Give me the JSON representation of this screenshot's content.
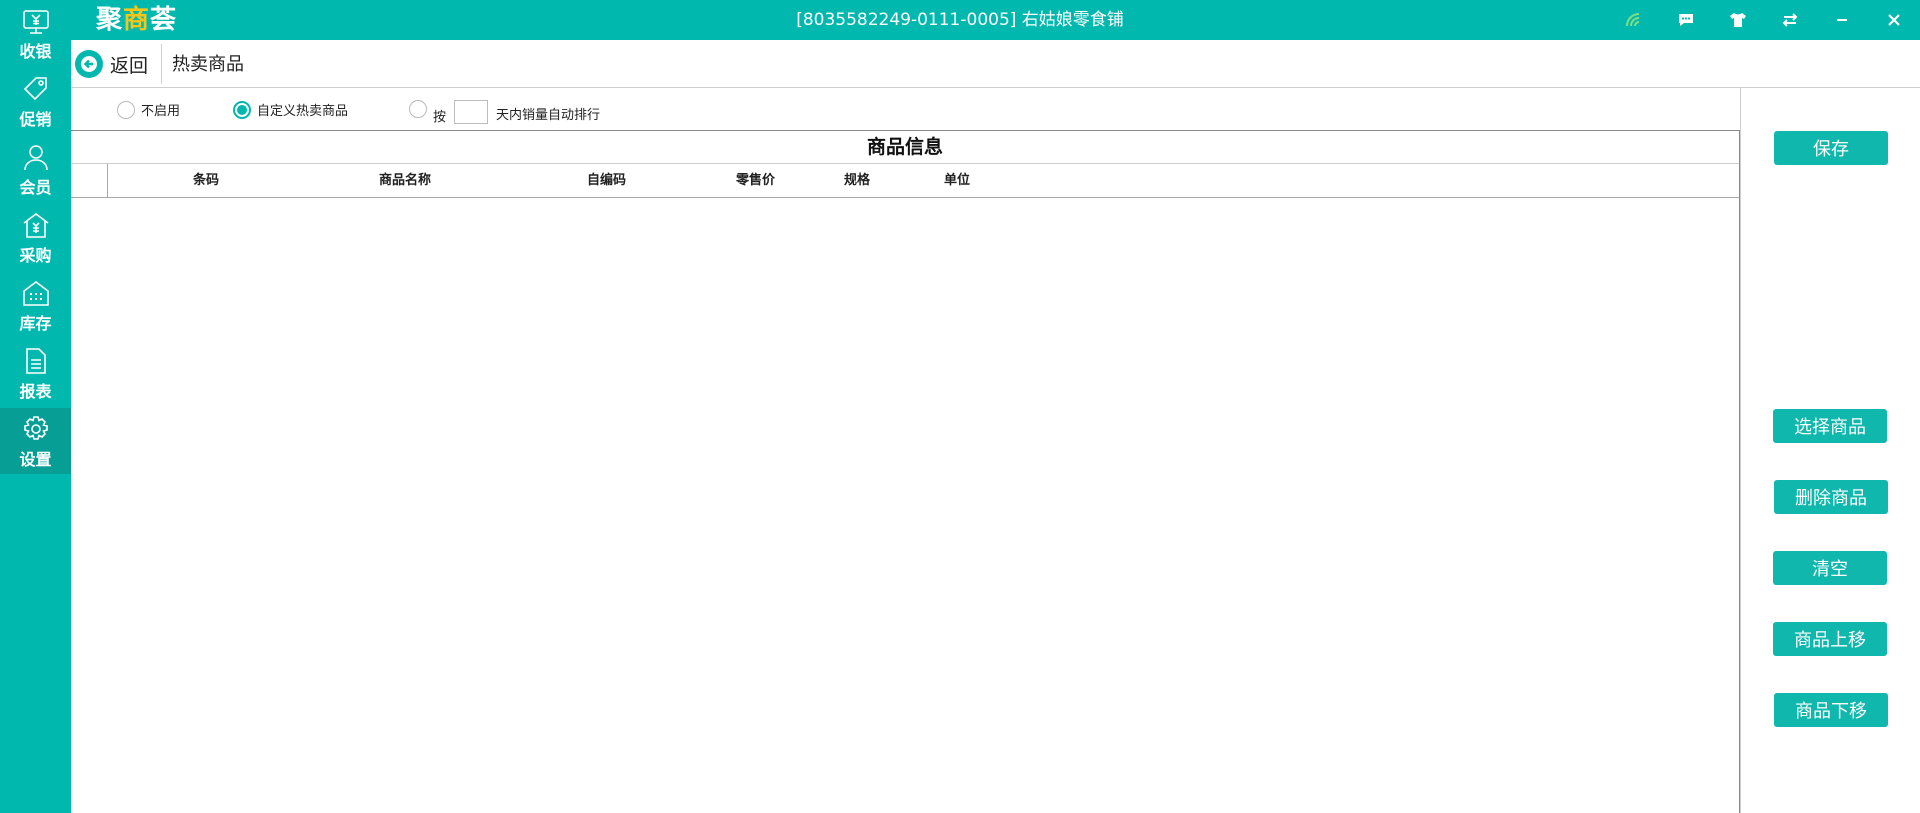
{
  "app": {
    "logo_main": "聚",
    "logo_highlight": "商",
    "logo_tail": "荟",
    "window_title": "[8035582249-0111-0005] 右姑娘零食铺",
    "title_icons": [
      "wifi-icon",
      "message-icon",
      "shirt-icon",
      "switch-icon",
      "minimize-icon",
      "close-icon"
    ]
  },
  "sidebar": {
    "items": [
      {
        "label": "收银",
        "icon": "cashier-icon"
      },
      {
        "label": "促销",
        "icon": "tag-icon"
      },
      {
        "label": "会员",
        "icon": "user-icon"
      },
      {
        "label": "采购",
        "icon": "purchase-icon"
      },
      {
        "label": "库存",
        "icon": "warehouse-icon"
      },
      {
        "label": "报表",
        "icon": "document-icon"
      },
      {
        "label": "设置",
        "icon": "gear-icon",
        "active": true
      }
    ]
  },
  "header": {
    "back_label": "返回",
    "page_title": "热卖商品"
  },
  "options": {
    "disable_label": "不启用",
    "custom_label": "自定义热卖商品",
    "by_prefix": "按",
    "days_value": "",
    "by_suffix": "天内销量自动排行",
    "selected": "custom"
  },
  "grid": {
    "title": "商品信息",
    "columns": [
      "条码",
      "商品名称",
      "自编码",
      "零售价",
      "规格",
      "单位"
    ],
    "rows": []
  },
  "actions": {
    "save": "保存",
    "select_goods": "选择商品",
    "delete_goods": "删除商品",
    "clear": "清空",
    "move_up": "商品上移",
    "move_down": "商品下移"
  },
  "colors": {
    "brand": "#00b8ae",
    "brand_dark": "#069e95",
    "logo_accent": "#f5c518"
  }
}
